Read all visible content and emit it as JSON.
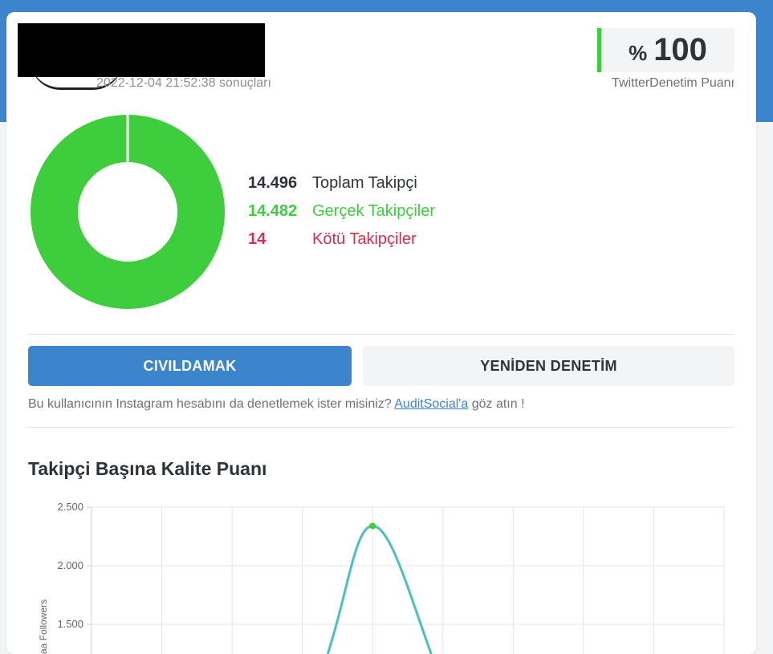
{
  "header": {
    "date_text": "2022-12-04 21:52:38 sonuçları"
  },
  "score": {
    "prefix": "%",
    "value": "100",
    "label": "TwitterDenetim Puanı"
  },
  "donut": {
    "real_fraction": 0.999,
    "bad_fraction": 0.001,
    "colors": {
      "real": "#3dcd3d",
      "bad": "#d0314f"
    }
  },
  "stats": {
    "total": {
      "value": "14.496",
      "label": "Toplam Takipçi"
    },
    "real": {
      "value": "14.482",
      "label": "Gerçek Takipçiler"
    },
    "bad": {
      "value": "14",
      "label": "Kötü Takipçiler"
    }
  },
  "actions": {
    "tweet_label": "CIVILDAMAK",
    "reaudit_label": "YENİDEN DENETİM"
  },
  "hint": {
    "before": "Bu kullanıcının Instagram hesabını da denetlemek ister misiniz? ",
    "link": "AuditSocial'a",
    "after": " göz atın !"
  },
  "section": {
    "title": "Takipçi Başına Kalite Puanı"
  },
  "chart_data": {
    "type": "line",
    "ylabel_visible": "aa Followers",
    "yticks": [
      "2.500",
      "2.000",
      "1.500"
    ],
    "ylim_visible": [
      1500,
      2500
    ],
    "line_color": "#4bc0c0",
    "point_color": "#3dcd3d",
    "x_categories_count": 9,
    "peak": {
      "index": 4,
      "value": 2340
    },
    "grid": true
  },
  "colors": {
    "accent": "#3c84cc",
    "success": "#3dcd3d",
    "danger": "#d0314f"
  }
}
